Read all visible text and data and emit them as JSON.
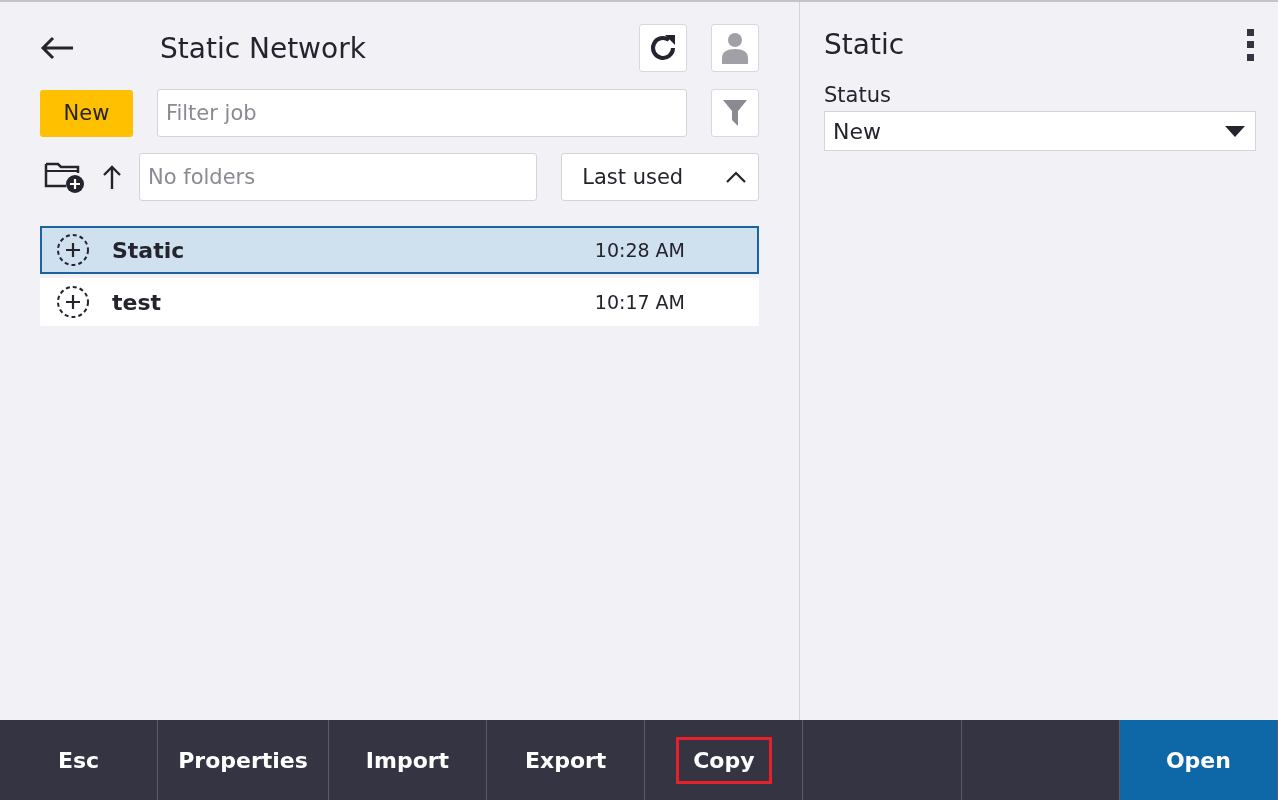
{
  "header": {
    "title": "Static Network"
  },
  "new_button": "New",
  "filter": {
    "placeholder": "Filter job"
  },
  "folder": {
    "placeholder": "No folders"
  },
  "sort": {
    "label": "Last used",
    "ascending": true
  },
  "jobs": [
    {
      "name": "Static",
      "time": "10:28 AM",
      "selected": true
    },
    {
      "name": "test",
      "time": "10:17 AM",
      "selected": false
    }
  ],
  "details": {
    "title": "Static",
    "status_label": "Status",
    "status_value": "New"
  },
  "softkeys": [
    {
      "label": "Esc",
      "highlighted": false,
      "primary": false
    },
    {
      "label": "Properties",
      "highlighted": false,
      "primary": false
    },
    {
      "label": "Import",
      "highlighted": false,
      "primary": false
    },
    {
      "label": "Export",
      "highlighted": false,
      "primary": false
    },
    {
      "label": "Copy",
      "highlighted": true,
      "primary": false
    },
    {
      "label": "Open",
      "highlighted": false,
      "primary": true
    }
  ]
}
